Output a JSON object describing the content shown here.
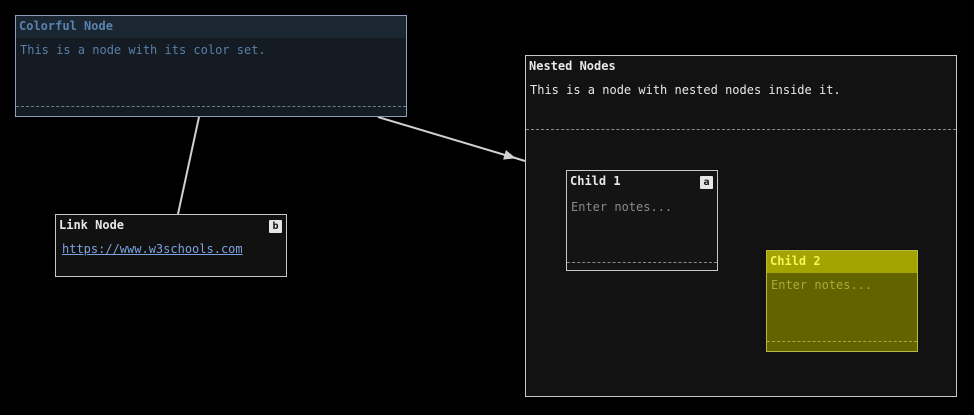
{
  "colors": {
    "background": "#000000",
    "edge": "#d0d0d0",
    "colorful_title": "#5a82ad",
    "child2_fill": "#636400",
    "child2_title": "#a3a400"
  },
  "nodes": {
    "colorful": {
      "title": "Colorful Node",
      "text": "This is a node with its color set."
    },
    "link": {
      "title": "Link Node",
      "badge": "b",
      "url": "https://www.w3schools.com"
    },
    "nested": {
      "title": "Nested Nodes",
      "text": "This is a node with nested nodes inside it."
    },
    "child1": {
      "title": "Child 1",
      "badge": "a",
      "placeholder": "Enter notes..."
    },
    "child2": {
      "title": "Child 2",
      "placeholder": "Enter notes..."
    }
  },
  "edges": [
    {
      "from": "colorful",
      "to": "link",
      "arrow": false
    },
    {
      "from": "colorful",
      "to": "nested",
      "arrow": true
    },
    {
      "from": "child1",
      "to": "child2",
      "arrow": false
    }
  ]
}
